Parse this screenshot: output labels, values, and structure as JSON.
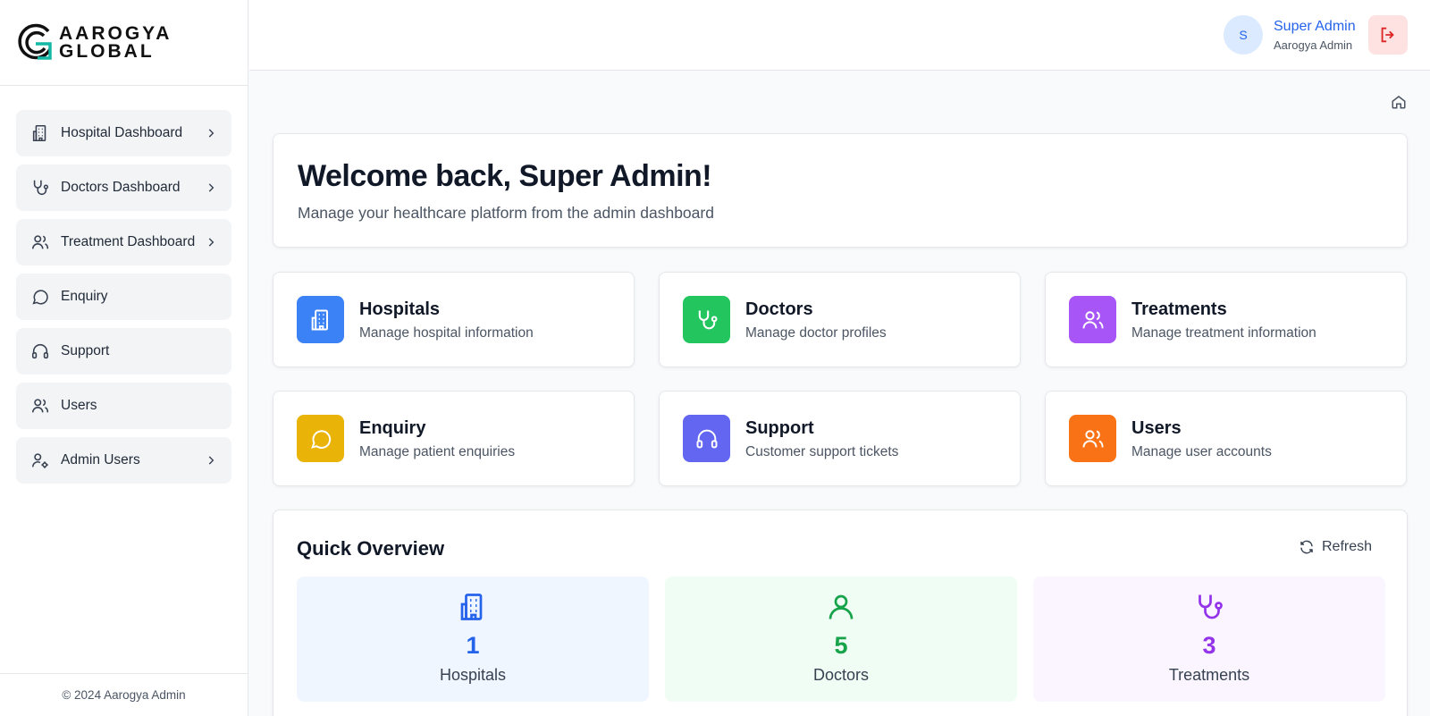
{
  "brand": {
    "line1": "AAROGYA",
    "line2": "GLOBAL"
  },
  "sidebar": {
    "items": [
      {
        "label": "Hospital Dashboard"
      },
      {
        "label": "Doctors Dashboard"
      },
      {
        "label": "Treatment Dashboard"
      },
      {
        "label": "Enquiry"
      },
      {
        "label": "Support"
      },
      {
        "label": "Users"
      },
      {
        "label": "Admin Users"
      }
    ],
    "footer": "© 2024 Aarogya Admin"
  },
  "header": {
    "avatar_initial": "S",
    "user_name": "Super Admin",
    "user_role": "Aarogya Admin"
  },
  "welcome": {
    "title": "Welcome back, Super Admin!",
    "subtitle": "Manage your healthcare platform from the admin dashboard"
  },
  "modules": [
    {
      "title": "Hospitals",
      "desc": "Manage hospital information",
      "color": "#3b82f6",
      "icon": "hospital-icon"
    },
    {
      "title": "Doctors",
      "desc": "Manage doctor profiles",
      "color": "#22c55e",
      "icon": "stethoscope-icon"
    },
    {
      "title": "Treatments",
      "desc": "Manage treatment information",
      "color": "#a855f7",
      "icon": "users-icon"
    },
    {
      "title": "Enquiry",
      "desc": "Manage patient enquiries",
      "color": "#eab308",
      "icon": "message-icon"
    },
    {
      "title": "Support",
      "desc": "Customer support tickets",
      "color": "#6366f1",
      "icon": "headphones-icon"
    },
    {
      "title": "Users",
      "desc": "Manage user accounts",
      "color": "#f97316",
      "icon": "users-icon"
    }
  ],
  "overview": {
    "title": "Quick Overview",
    "refresh_label": "Refresh",
    "stats": [
      {
        "value": "1",
        "label": "Hospitals",
        "color": "#2563eb",
        "bg": "#eff6ff"
      },
      {
        "value": "5",
        "label": "Doctors",
        "color": "#16a34a",
        "bg": "#f0fdf4"
      },
      {
        "value": "3",
        "label": "Treatments",
        "color": "#9333ea",
        "bg": "#faf5ff"
      }
    ]
  }
}
